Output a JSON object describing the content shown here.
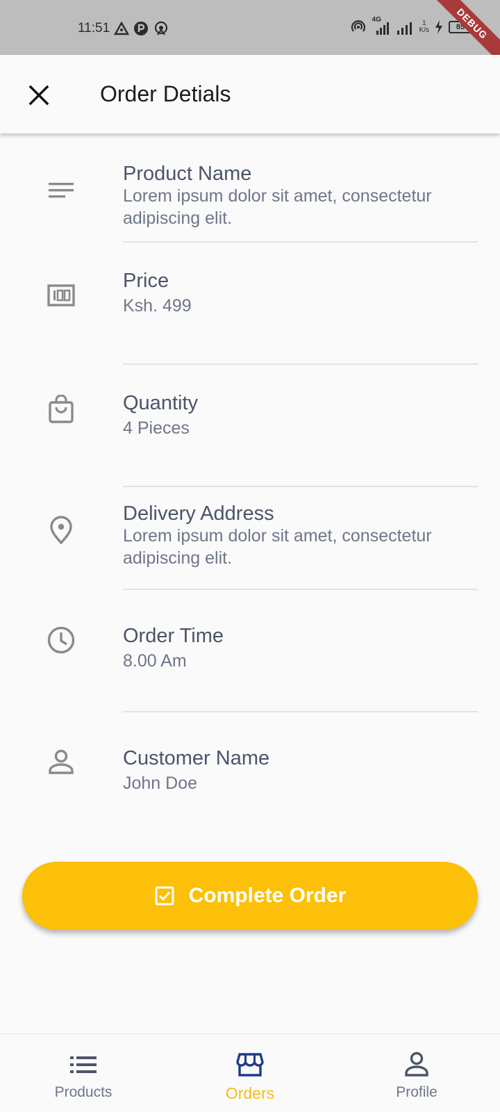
{
  "status_bar": {
    "time": "11:51",
    "network_type": "4G",
    "speed_value": "1",
    "speed_unit": "K/s",
    "battery": "85",
    "debug_label": "DEBUG"
  },
  "header": {
    "title": "Order Detials",
    "close_icon": "close-icon"
  },
  "details": [
    {
      "icon": "short-text-icon",
      "label": "Product Name",
      "value": "Lorem ipsum dolor sit amet, consectetur adipiscing elit."
    },
    {
      "icon": "money-icon",
      "label": "Price",
      "value": "Ksh. 499"
    },
    {
      "icon": "shopping-bag-icon",
      "label": "Quantity",
      "value": "4 Pieces"
    },
    {
      "icon": "location-pin-icon",
      "label": "Delivery Address",
      "value": "Lorem ipsum dolor sit amet, consectetur adipiscing elit."
    },
    {
      "icon": "clock-icon",
      "label": "Order Time",
      "value": "8.00 Am"
    },
    {
      "icon": "person-icon",
      "label": "Customer Name",
      "value": "John Doe"
    }
  ],
  "action": {
    "label": "Complete Order",
    "icon": "check-box-icon",
    "color": "#fdc008"
  },
  "bottom_nav": {
    "items": [
      {
        "label": "Products",
        "icon": "list-icon"
      },
      {
        "label": "Orders",
        "icon": "storefront-icon",
        "active": true
      },
      {
        "label": "Profile",
        "icon": "person-outline-icon"
      }
    ],
    "active_color": "#f4be18",
    "inactive_color": "#6e7689"
  }
}
